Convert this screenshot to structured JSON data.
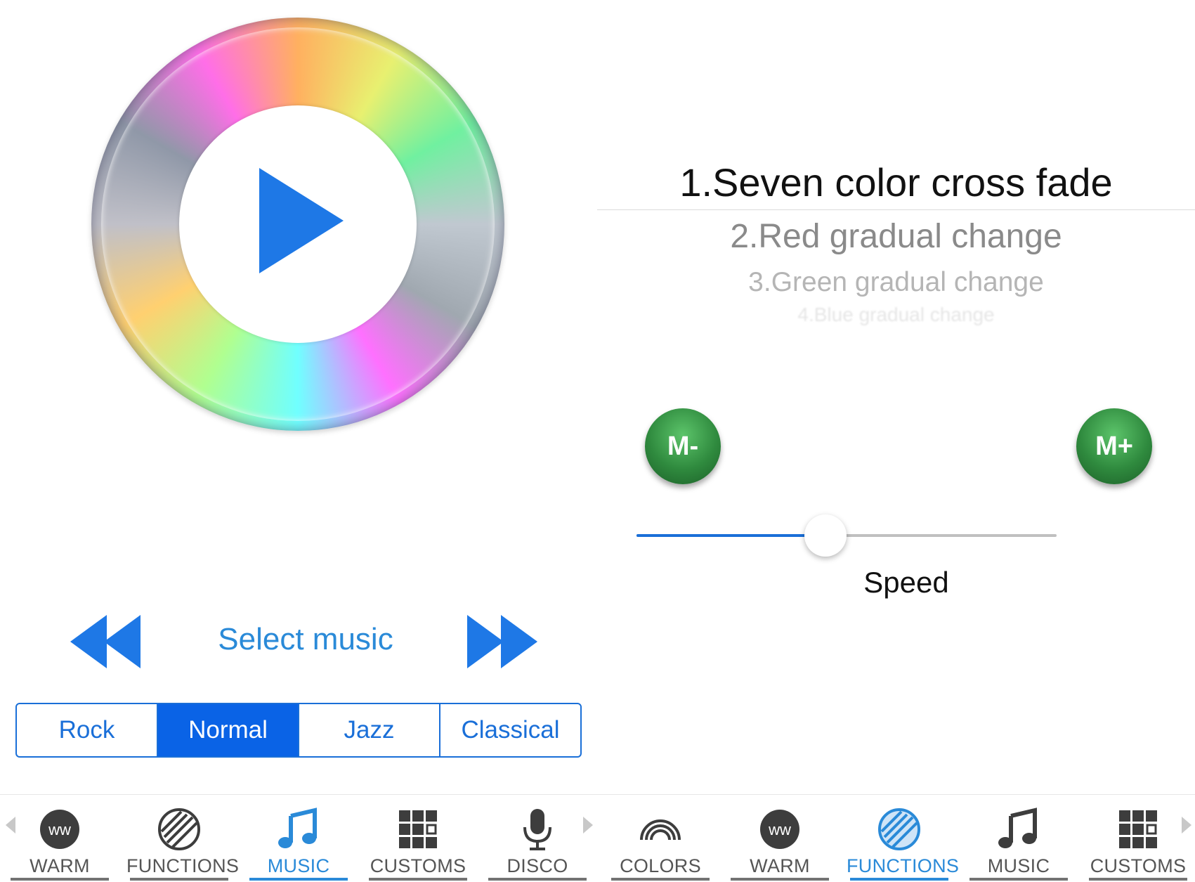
{
  "player": {
    "select_music": "Select music",
    "genres": [
      {
        "label": "Rock",
        "active": false
      },
      {
        "label": "Normal",
        "active": true
      },
      {
        "label": "Jazz",
        "active": false
      },
      {
        "label": "Classical",
        "active": false
      }
    ]
  },
  "modes": {
    "items": [
      "1.Seven color cross fade",
      "2.Red gradual change",
      "3.Green gradual change",
      "4.Blue gradual change"
    ],
    "selected_index": 0
  },
  "controls": {
    "m_minus": "M-",
    "m_plus": "M+",
    "speed_label": "Speed",
    "speed_value": 0.45
  },
  "tabs": [
    {
      "label": "WARM",
      "icon": "warm-icon",
      "active": false
    },
    {
      "label": "FUNCTIONS",
      "icon": "functions-icon",
      "active": false
    },
    {
      "label": "MUSIC",
      "icon": "music-note-icon",
      "active": true
    },
    {
      "label": "CUSTOMS",
      "icon": "grid-icon",
      "active": false
    },
    {
      "label": "DISCO",
      "icon": "microphone-icon",
      "active": false
    },
    {
      "label": "COLORS",
      "icon": "rainbow-icon",
      "active": false
    },
    {
      "label": "WARM",
      "icon": "warm-icon",
      "active": false
    },
    {
      "label": "FUNCTIONS",
      "icon": "functions-icon",
      "active": true
    },
    {
      "label": "MUSIC",
      "icon": "music-note-icon",
      "active": false
    },
    {
      "label": "CUSTOMS",
      "icon": "grid-icon",
      "active": false
    }
  ],
  "colors": {
    "accent": "#1a6fd8",
    "segment_active": "#0a63e6",
    "green_button": "#2f8a3e"
  }
}
